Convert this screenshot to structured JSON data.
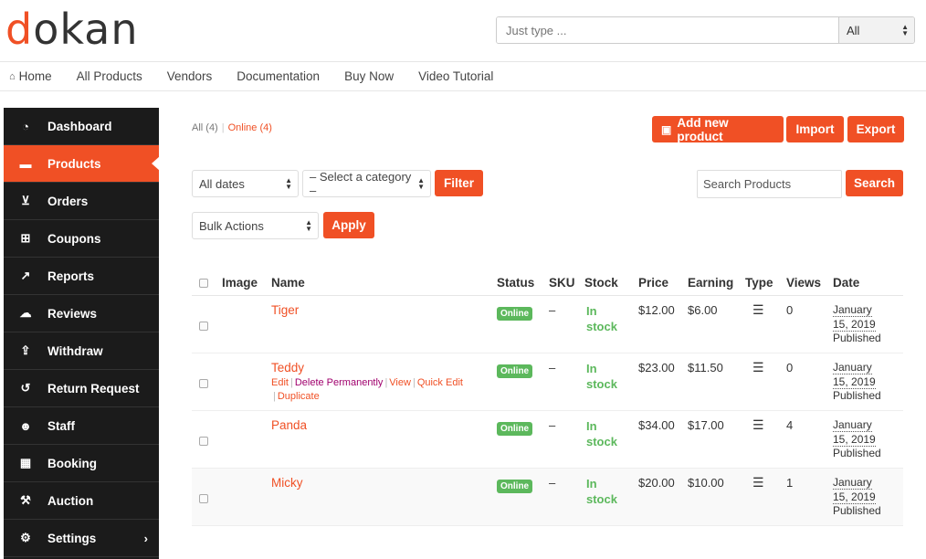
{
  "header": {
    "logo_first": "d",
    "logo_rest": "okan",
    "search_placeholder": "Just type ...",
    "search_scope": "All"
  },
  "topnav": {
    "items": [
      {
        "label": "Home",
        "icon": "home-icon"
      },
      {
        "label": "All Products"
      },
      {
        "label": "Vendors"
      },
      {
        "label": "Documentation"
      },
      {
        "label": "Buy Now"
      },
      {
        "label": "Video Tutorial"
      }
    ]
  },
  "sidebar": {
    "items": [
      {
        "label": "Dashboard",
        "icon": "dashboard-icon"
      },
      {
        "label": "Products",
        "icon": "briefcase-icon",
        "active": true
      },
      {
        "label": "Orders",
        "icon": "cart-icon"
      },
      {
        "label": "Coupons",
        "icon": "gift-icon"
      },
      {
        "label": "Reports",
        "icon": "line-chart-icon"
      },
      {
        "label": "Reviews",
        "icon": "comments-icon"
      },
      {
        "label": "Withdraw",
        "icon": "upload-icon"
      },
      {
        "label": "Return Request",
        "icon": "undo-icon"
      },
      {
        "label": "Staff",
        "icon": "users-icon"
      },
      {
        "label": "Booking",
        "icon": "calendar-icon"
      },
      {
        "label": "Auction",
        "icon": "gavel-icon"
      },
      {
        "label": "Settings",
        "icon": "gear-icon"
      }
    ]
  },
  "status_filter": {
    "all": "All (4)",
    "online": "Online (4)"
  },
  "toolbar": {
    "add_new": "Add new product",
    "import": "Import",
    "export": "Export",
    "dates": "All dates",
    "category": "– Select a category –",
    "filter": "Filter",
    "search_placeholder": "Search Products",
    "search": "Search",
    "bulk": "Bulk Actions",
    "apply": "Apply"
  },
  "table": {
    "headers": [
      "Image",
      "Name",
      "Status",
      "SKU",
      "Stock",
      "Price",
      "Earning",
      "Type",
      "Views",
      "Date"
    ],
    "row_actions": {
      "edit": "Edit",
      "delete": "Delete Permanently",
      "view": "View",
      "quick_edit": "Quick Edit",
      "duplicate": "Duplicate"
    },
    "rows": [
      {
        "name": "Tiger",
        "status": "Online",
        "sku": "–",
        "stock_1": "In",
        "stock_2": "stock",
        "price": "$12.00",
        "earning": "$6.00",
        "views": "0",
        "date_1": "January",
        "date_2": "15, 2019",
        "date_3": "Published"
      },
      {
        "name": "Teddy",
        "status": "Online",
        "sku": "–",
        "stock_1": "In",
        "stock_2": "stock",
        "price": "$23.00",
        "earning": "$11.50",
        "views": "0",
        "date_1": "January",
        "date_2": "15, 2019",
        "date_3": "Published"
      },
      {
        "name": "Panda",
        "status": "Online",
        "sku": "–",
        "stock_1": "In",
        "stock_2": "stock",
        "price": "$34.00",
        "earning": "$17.00",
        "views": "4",
        "date_1": "January",
        "date_2": "15, 2019",
        "date_3": "Published"
      },
      {
        "name": "Micky",
        "status": "Online",
        "sku": "–",
        "stock_1": "In",
        "stock_2": "stock",
        "price": "$20.00",
        "earning": "$10.00",
        "views": "1",
        "date_1": "January",
        "date_2": "15, 2019",
        "date_3": "Published"
      }
    ]
  },
  "colors": {
    "accent": "#f05025",
    "sidebar_bg": "#1b1b1b",
    "online_badge": "#5cb85c"
  }
}
